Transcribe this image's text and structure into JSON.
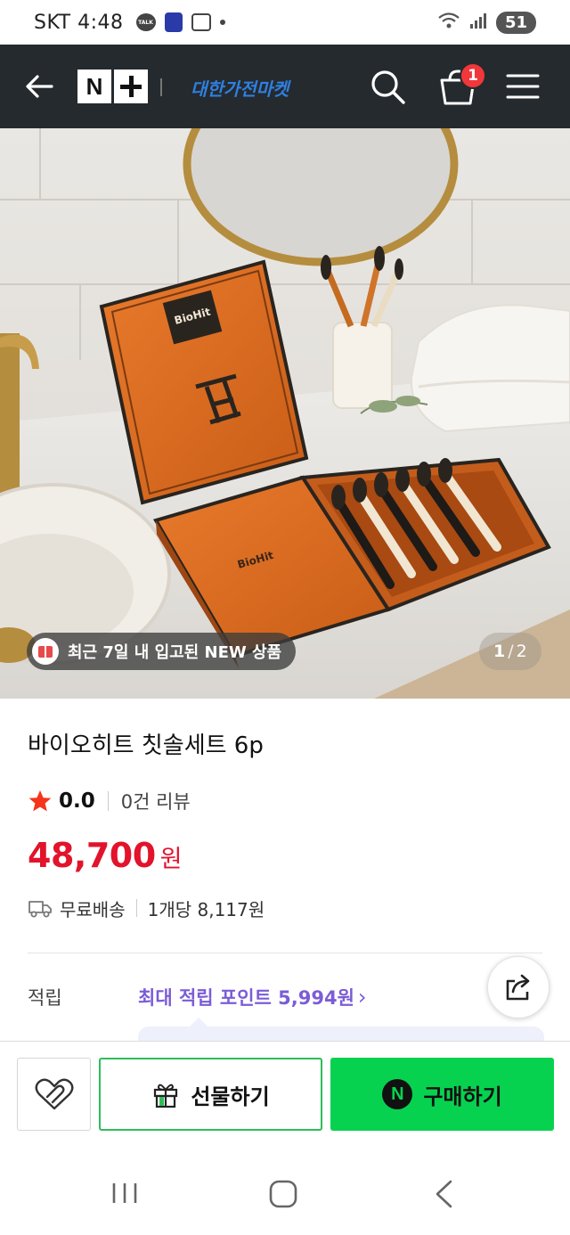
{
  "status_bar": {
    "carrier": "SKT",
    "time": "4:48",
    "talk_label": "TALK",
    "battery": "51"
  },
  "header": {
    "store_name": "대한가전마켓",
    "cart_count": "1",
    "logo_letter": "N"
  },
  "image": {
    "new_badge": "최근 7일 내 입고된 NEW 상품",
    "page_current": "1",
    "page_separator": "/",
    "page_total": "2",
    "brand_on_box": "BioHit"
  },
  "product": {
    "title": "바이오히트 칫솔세트 6p",
    "rating": "0.0",
    "review_count": "0건 리뷰",
    "price": "48,700",
    "price_unit": "원",
    "delivery": "무료배송",
    "unit_price": "1개당 8,117원"
  },
  "points": {
    "label": "적립",
    "link": "최대 적립 포인트 5,994원"
  },
  "actions": {
    "gift": "선물하기",
    "buy": "구매하기"
  },
  "colors": {
    "header_bg": "#252a2e",
    "price": "#e2132b",
    "points": "#7b5cd6",
    "buy_bg": "#07d250",
    "gift_border": "#2ebd59",
    "badge": "#f0373b"
  }
}
